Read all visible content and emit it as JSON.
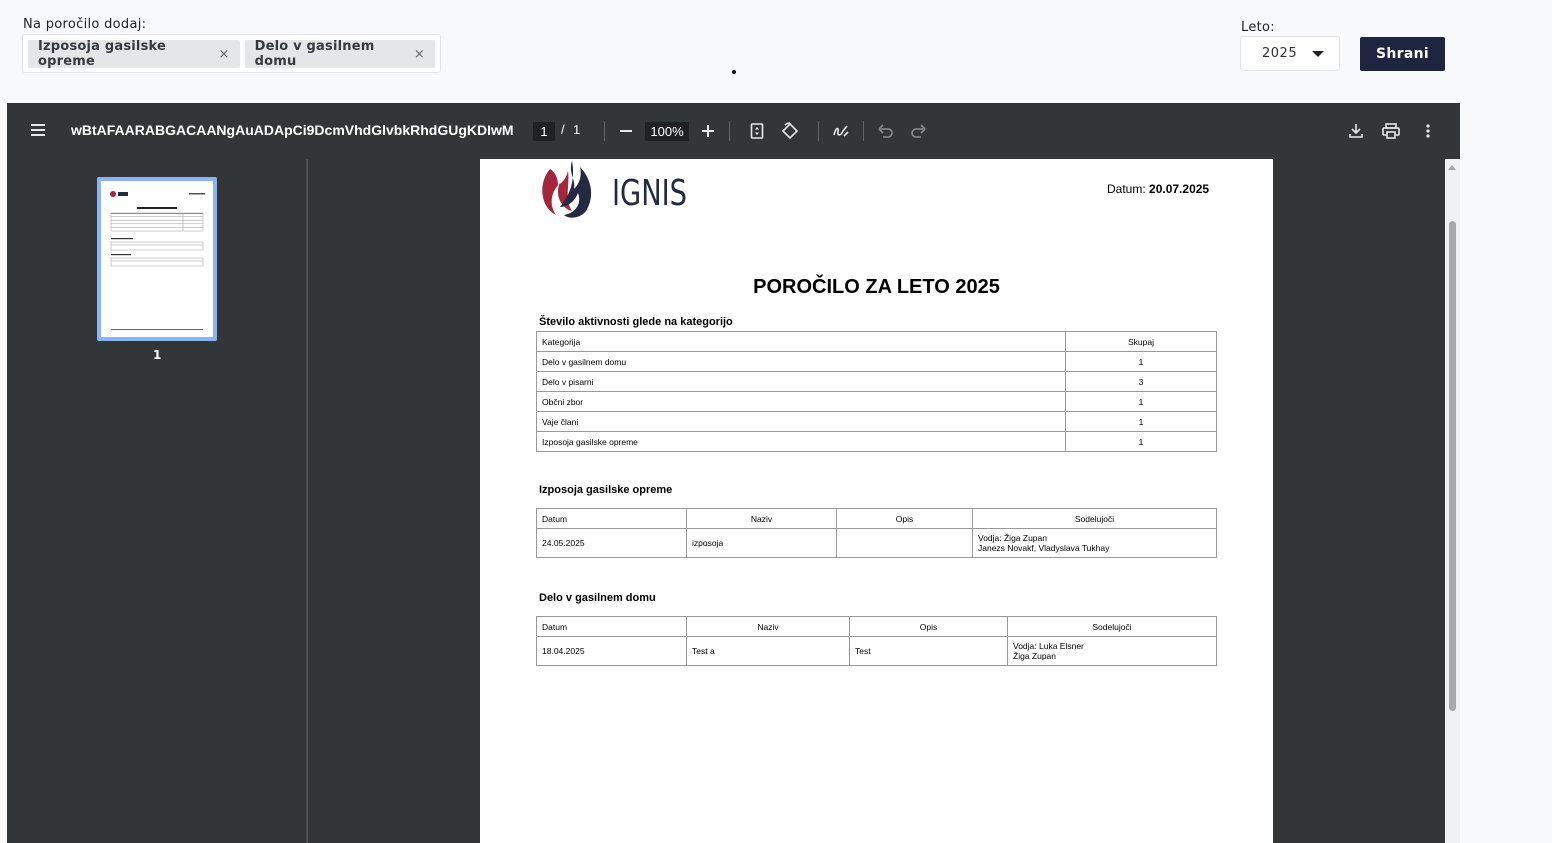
{
  "form": {
    "add_label": "Na poročilo dodaj:",
    "chips": [
      {
        "label": "Izposoja gasilske opreme",
        "remove": "×"
      },
      {
        "label": "Delo v gasilnem domu",
        "remove": "×"
      }
    ],
    "year_label": "Leto:",
    "year_value": "2025",
    "save_label": "Shrani"
  },
  "viewer": {
    "doc_title": "wBtAFAARABGACAANgAuADApCi9DcmVhdGlvbkRhdGUgKDIwMjU...",
    "page_current": "1",
    "page_separator": "/",
    "page_total": "1",
    "zoom": "100%",
    "thumb_label": "1",
    "icons": [
      "menu-icon",
      "zoom-out-icon",
      "zoom-in-icon",
      "fit-page-icon",
      "rotate-icon",
      "annotate-icon",
      "undo-icon",
      "redo-icon",
      "download-icon",
      "print-icon",
      "more-icon"
    ]
  },
  "report": {
    "logo_text": "IGNIS",
    "date_label": "Datum:",
    "date_value": "20.07.2025",
    "title": "POROČILO ZA LETO 2025",
    "section1": {
      "title": "Število aktivnosti glede na kategorijo",
      "headers": [
        "Kategorija",
        "Skupaj"
      ],
      "rows": [
        [
          "Delo v gasilnem domu",
          "1"
        ],
        [
          "Delo v pisarni",
          "3"
        ],
        [
          "Občni zbor",
          "1"
        ],
        [
          "Vaje člani",
          "1"
        ],
        [
          "Izposoja gasilske opreme",
          "1"
        ]
      ]
    },
    "section2": {
      "title": "Izposoja gasilske opreme",
      "headers": [
        "Datum",
        "Naziv",
        "Opis",
        "Sodelujoči"
      ],
      "row": {
        "datum": "24.05.2025",
        "naziv": "izposoja",
        "opis": "",
        "vodja": "Vodja: Žiga Zupan",
        "clani": "Janezs Novakf, Vladyslava Tukhay"
      }
    },
    "section3": {
      "title": "Delo v gasilnem domu",
      "headers": [
        "Datum",
        "Naziv",
        "Opis",
        "Sodelujoči"
      ],
      "row": {
        "datum": "18.04.2025",
        "naziv": "Test a",
        "opis": "Test",
        "vodja": "Vodja: Luka Elsner",
        "clani": "Žiga Zupan"
      }
    }
  },
  "colors": {
    "accent": "#1f2541",
    "toolbar": "#323639",
    "thumb_border": "#8ab4f8",
    "logo_red": "#a3263d",
    "logo_navy": "#232a42"
  }
}
